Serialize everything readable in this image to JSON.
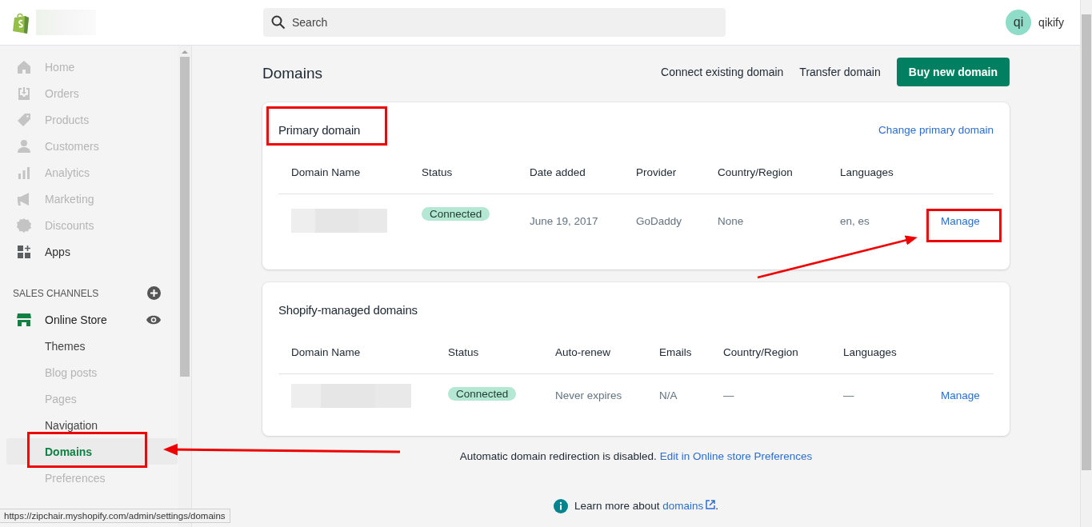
{
  "topbar": {
    "search": {
      "placeholder": "Search"
    },
    "user": {
      "initials": "qi",
      "name": "qikify"
    }
  },
  "sidebar": {
    "items": [
      {
        "label": "Home",
        "disabled": true,
        "selected": false
      },
      {
        "label": "Orders",
        "disabled": true,
        "selected": false
      },
      {
        "label": "Products",
        "disabled": true,
        "selected": false
      },
      {
        "label": "Customers",
        "disabled": true,
        "selected": false
      },
      {
        "label": "Analytics",
        "disabled": true,
        "selected": false
      },
      {
        "label": "Marketing",
        "disabled": true,
        "selected": false
      },
      {
        "label": "Discounts",
        "disabled": true,
        "selected": false
      },
      {
        "label": "Apps",
        "disabled": false,
        "selected": false
      }
    ],
    "section_title": "SALES CHANNELS",
    "channel": {
      "label": "Online Store",
      "children": [
        {
          "label": "Themes",
          "disabled": false,
          "selected": false
        },
        {
          "label": "Blog posts",
          "disabled": true,
          "selected": false
        },
        {
          "label": "Pages",
          "disabled": true,
          "selected": false
        },
        {
          "label": "Navigation",
          "disabled": false,
          "selected": false
        },
        {
          "label": "Domains",
          "disabled": false,
          "selected": true
        },
        {
          "label": "Preferences",
          "disabled": true,
          "selected": false
        }
      ]
    }
  },
  "page": {
    "title": "Domains",
    "actions": [
      {
        "label": "Connect existing domain",
        "kind": "plain"
      },
      {
        "label": "Transfer domain",
        "kind": "plain"
      },
      {
        "label": "Buy new domain",
        "kind": "primary"
      }
    ],
    "cards": [
      {
        "kind": "primary",
        "title": "Primary domain",
        "link": "Change primary domain",
        "columns": [
          "Domain Name",
          "Status",
          "Date added",
          "Provider",
          "Country/Region",
          "Languages"
        ],
        "rows": [
          [
            {
              "kind": "blurred"
            },
            {
              "kind": "badge",
              "text": "Connected"
            },
            {
              "kind": "text",
              "text": "June 19, 2017"
            },
            {
              "kind": "text",
              "text": "GoDaddy"
            },
            {
              "kind": "text",
              "text": "None"
            },
            {
              "kind": "text",
              "text": "en, es"
            },
            {
              "kind": "link",
              "text": "Manage"
            }
          ]
        ]
      },
      {
        "kind": "managed",
        "title": "Shopify-managed domains",
        "columns": [
          "Domain Name",
          "Status",
          "Auto-renew",
          "Emails",
          "Country/Region",
          "Languages"
        ],
        "rows": [
          [
            {
              "kind": "blurred"
            },
            {
              "kind": "badge",
              "text": "Connected"
            },
            {
              "kind": "text",
              "text": "Never expires"
            },
            {
              "kind": "text",
              "text": "N/A"
            },
            {
              "kind": "text",
              "text": "—"
            },
            {
              "kind": "text",
              "text": "—"
            },
            {
              "kind": "link",
              "text": "Manage"
            }
          ]
        ]
      }
    ],
    "redirect_note": {
      "text": "Automatic domain redirection is disabled.",
      "link": "Edit in Online store Preferences"
    },
    "learn_more": {
      "text": "Learn more about",
      "link": "domains",
      "end": "."
    }
  },
  "status_bar": {
    "url": "https://zipchair.myshopify.com/admin/settings/domains"
  }
}
